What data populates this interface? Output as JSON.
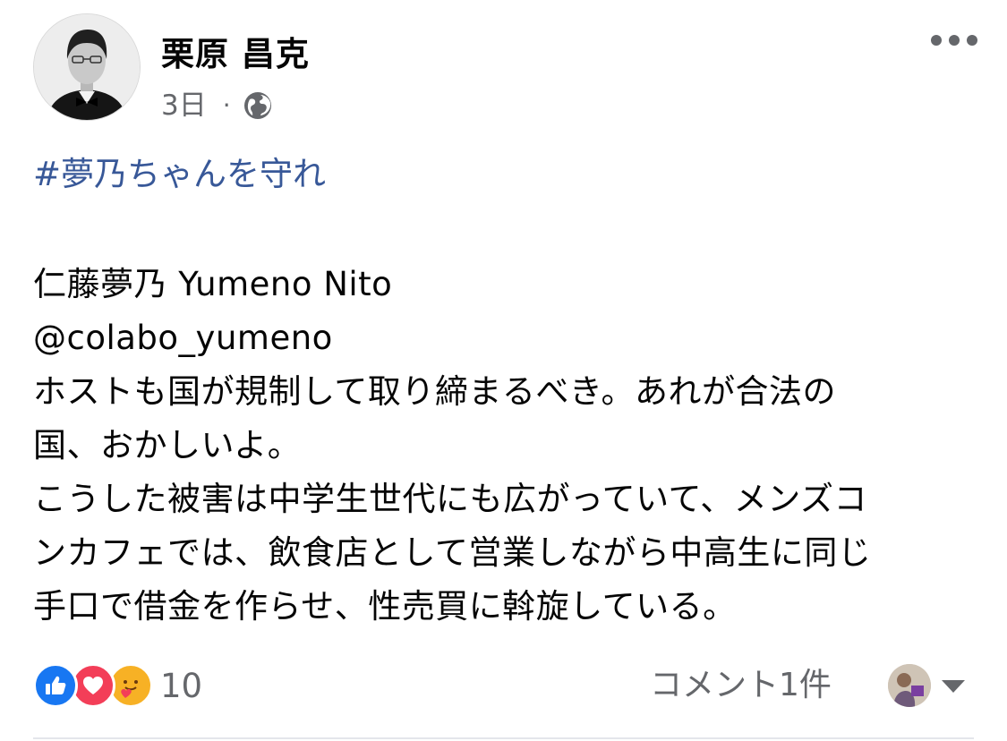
{
  "post": {
    "author": "栗原 昌克",
    "timestamp": "3日",
    "separator": "·",
    "privacy_icon": "globe-icon",
    "more_icon": "more-horizontal-icon",
    "hashtag": "#夢乃ちゃんを守れ",
    "lines": [
      "仁藤夢乃 Yumeno Nito",
      "@colabo_yumeno",
      "ホストも国が規制して取り締まるべき。あれが合法の",
      "国、おかしいよ。",
      "こうした被害は中学生世代にも広がっていて、メンズコ",
      "ンカフェでは、飲食店として営業しながら中高生に同じ",
      "手口で借金を作らせ、性売買に斡旋している。"
    ]
  },
  "footer": {
    "reaction_icons": [
      "like-icon",
      "love-icon",
      "care-icon"
    ],
    "reaction_count": "10",
    "comment_count_label": "コメント1件"
  },
  "colors": {
    "hashtag": "#385898",
    "secondary_text": "#65676b",
    "like": "#1877f2",
    "love": "#f33e58",
    "care": "#f7b125"
  }
}
